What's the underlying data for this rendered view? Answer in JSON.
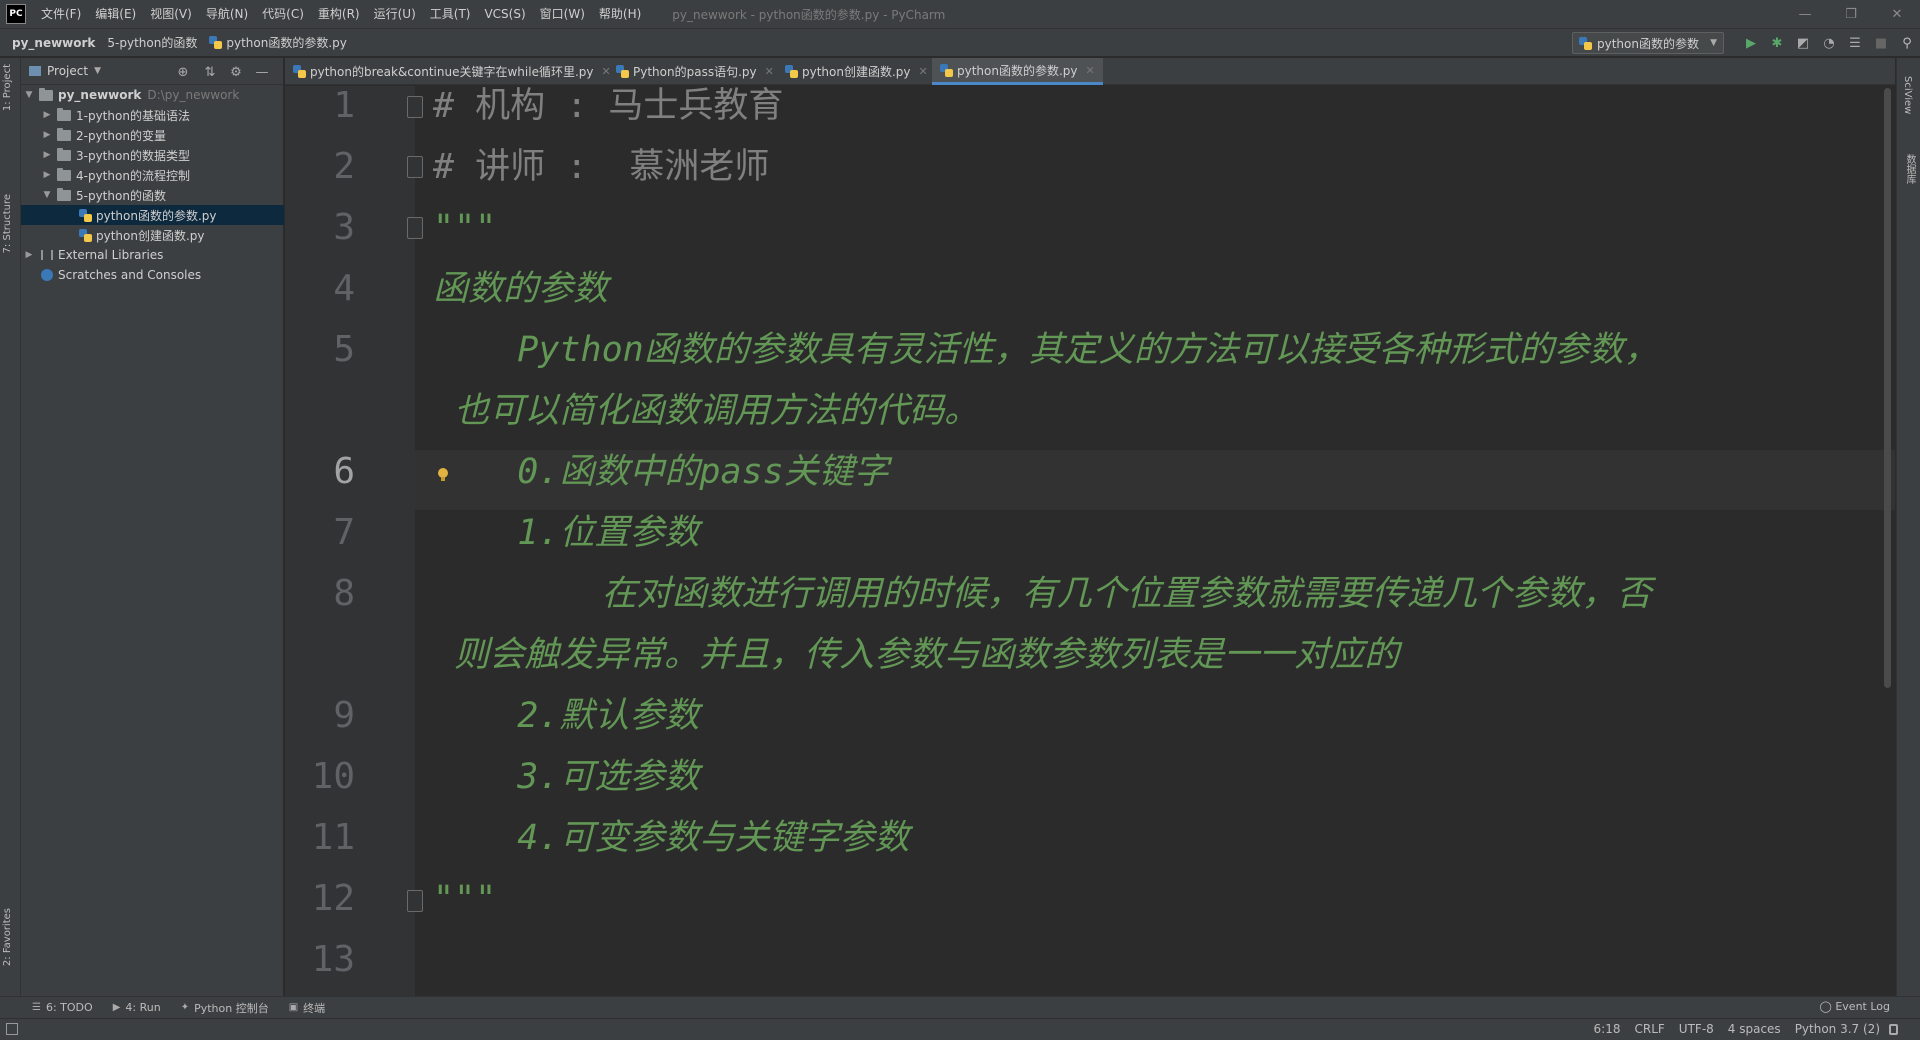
{
  "app": {
    "logo": "PC",
    "window_title": "py_newwork - python函数的参数.py - PyCharm",
    "menu": [
      "文件(F)",
      "编辑(E)",
      "视图(V)",
      "导航(N)",
      "代码(C)",
      "重构(R)",
      "运行(U)",
      "工具(T)",
      "VCS(S)",
      "窗口(W)",
      "帮助(H)"
    ],
    "window_controls": [
      "—",
      "❐",
      "✕"
    ]
  },
  "breadcrumb": {
    "project": "py_newwork",
    "folder": "5-python的函数",
    "file": "python函数的参数.py"
  },
  "run_config": {
    "label": "python函数的参数"
  },
  "toolbar_icons": [
    "run-icon",
    "debug-icon",
    "coverage-icon",
    "profile-icon",
    "build-icon",
    "stop-icon",
    "search-icon"
  ],
  "colors": {
    "accent": "#4a88c7",
    "run_green": "#59a869",
    "docstring": "#629755",
    "comment": "#808080"
  },
  "left_strip": {
    "project_tab": "1: Project",
    "structure_tab": "7: Structure",
    "favorites_tab": "2: Favorites"
  },
  "project_panel": {
    "title": "Project",
    "tree": [
      {
        "label": "py_newwork",
        "path": "D:\\py_newwork",
        "type": "root",
        "expanded": true
      },
      {
        "label": "1-python的基础语法",
        "type": "folder",
        "expanded": false
      },
      {
        "label": "2-python的变量",
        "type": "folder",
        "expanded": false
      },
      {
        "label": "3-python的数据类型",
        "type": "folder",
        "expanded": false
      },
      {
        "label": "4-python的流程控制",
        "type": "folder",
        "expanded": false
      },
      {
        "label": "5-python的函数",
        "type": "folder",
        "expanded": true
      },
      {
        "label": "python函数的参数.py",
        "type": "file",
        "selected": true
      },
      {
        "label": "python创建函数.py",
        "type": "file"
      },
      {
        "label": "External Libraries",
        "type": "lib"
      },
      {
        "label": "Scratches and Consoles",
        "type": "scratch"
      }
    ]
  },
  "tabs": [
    {
      "label": "python的break&continue关键字在while循环里.py"
    },
    {
      "label": "Python的pass语句.py"
    },
    {
      "label": "python创建函数.py"
    },
    {
      "label": "python函数的参数.py",
      "active": true
    }
  ],
  "editor": {
    "current_line": "6",
    "line_numbers": [
      "1",
      "2",
      "3",
      "4",
      "5",
      "6",
      "7",
      "8",
      "9",
      "10",
      "11",
      "12",
      "13"
    ],
    "lines": [
      {
        "text": "# 机构 : 马士兵教育",
        "style": "comment"
      },
      {
        "text": "# 讲师 :  慕洲老师",
        "style": "comment"
      },
      {
        "text": "\"\"\"",
        "style": "doc"
      },
      {
        "text": "函数的参数",
        "style": "doc"
      },
      {
        "text": "    Python函数的参数具有灵活性，其定义的方法可以接受各种形式的参数，",
        "style": "doc"
      },
      {
        "text": " 也可以简化函数调用方法的代码。",
        "style": "doc"
      },
      {
        "text": "    0.函数中的pass关键字",
        "style": "doc"
      },
      {
        "text": "    1.位置参数",
        "style": "doc"
      },
      {
        "text": "        在对函数进行调用的时候，有几个位置参数就需要传递几个参数，否",
        "style": "doc"
      },
      {
        "text": " 则会触发异常。并且，传入参数与函数参数列表是一一对应的",
        "style": "doc"
      },
      {
        "text": "    2.默认参数",
        "style": "doc"
      },
      {
        "text": "    3.可选参数",
        "style": "doc"
      },
      {
        "text": "    4.可变参数与关键字参数",
        "style": "doc"
      },
      {
        "text": "\"\"\"",
        "style": "doc"
      }
    ]
  },
  "right_strip": {
    "tab1": "SciView",
    "tab2": "数据库"
  },
  "bottom_tools": [
    {
      "label": "6: TODO",
      "icon": "list-icon"
    },
    {
      "label": "4: Run",
      "icon": "run-icon"
    },
    {
      "label": "Python 控制台",
      "icon": "python-console-icon"
    },
    {
      "label": "终端",
      "icon": "terminal-icon"
    }
  ],
  "event_log": "Event Log",
  "status": {
    "position": "6:18",
    "line_sep": "CRLF",
    "encoding": "UTF-8",
    "indent": "4 spaces",
    "interpreter": "Python 3.7 (2)"
  }
}
